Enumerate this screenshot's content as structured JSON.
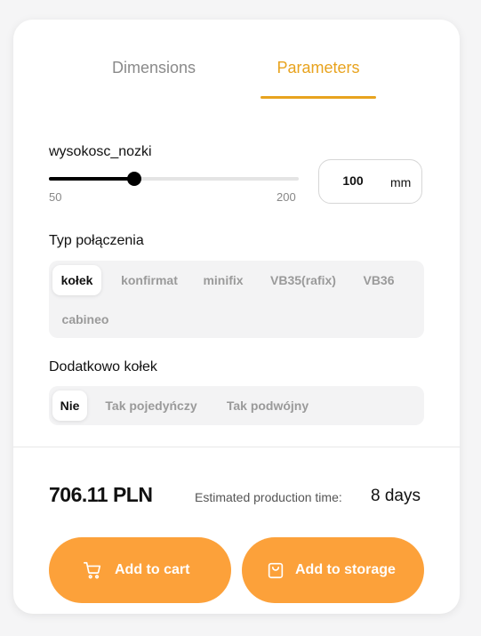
{
  "tabs": {
    "dimensions": "Dimensions",
    "parameters": "Parameters",
    "active": "parameters"
  },
  "wysokosc": {
    "label": "wysokosc_nozki",
    "min": "50",
    "max": "200",
    "value": "100",
    "unit": "mm",
    "fraction": 0.33
  },
  "typ_polaczenia": {
    "label": "Typ połączenia",
    "options": [
      "kołek",
      "konfirmat",
      "minifix",
      "VB35(rafix)",
      "VB36",
      "cabineo"
    ],
    "selected": "kołek"
  },
  "dodatkowo_kolek": {
    "label": "Dodatkowo kołek",
    "options": [
      "Nie",
      "Tak pojedyńczy",
      "Tak podwójny"
    ],
    "selected": "Nie"
  },
  "summary": {
    "price": "706.11 PLN",
    "estimated_label": "Estimated production time:",
    "estimated_value": "8 days"
  },
  "actions": {
    "add_to_cart": "Add to cart",
    "add_to_storage": "Add to storage"
  },
  "colors": {
    "accent": "#e8a31e",
    "button": "#fca13a"
  }
}
